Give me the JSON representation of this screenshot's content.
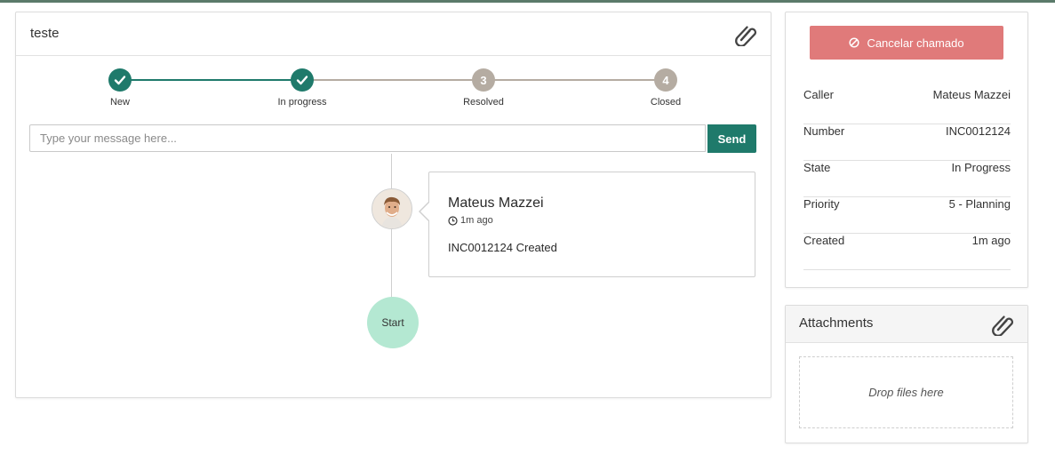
{
  "ticket": {
    "title": "teste"
  },
  "stepper": {
    "steps": [
      {
        "label": "New",
        "state": "done",
        "number": "1"
      },
      {
        "label": "In progress",
        "state": "done",
        "number": "2"
      },
      {
        "label": "Resolved",
        "state": "todo",
        "number": "3"
      },
      {
        "label": "Closed",
        "state": "todo",
        "number": "4"
      }
    ]
  },
  "composer": {
    "placeholder": "Type your message here...",
    "send_label": "Send"
  },
  "timeline": {
    "entry": {
      "author": "Mateus Mazzei",
      "time": "1m ago",
      "text": "INC0012124 Created"
    },
    "start_label": "Start"
  },
  "sidebar": {
    "cancel_label": "Cancelar chamado",
    "fields": [
      {
        "label": "Caller",
        "value": "Mateus Mazzei"
      },
      {
        "label": "Number",
        "value": "INC0012124"
      },
      {
        "label": "State",
        "value": "In Progress"
      },
      {
        "label": "Priority",
        "value": "5 - Planning"
      },
      {
        "label": "Created",
        "value": "1m ago"
      }
    ]
  },
  "attachments": {
    "title": "Attachments",
    "dropzone_label": "Drop files here"
  },
  "colors": {
    "primary": "#1f7a6b",
    "pending_step": "#b5aca2",
    "danger": "#e07a7a",
    "start_node": "#b4e8d2"
  },
  "icons": [
    "paperclip-icon",
    "check-icon",
    "clock-icon",
    "ban-icon"
  ]
}
